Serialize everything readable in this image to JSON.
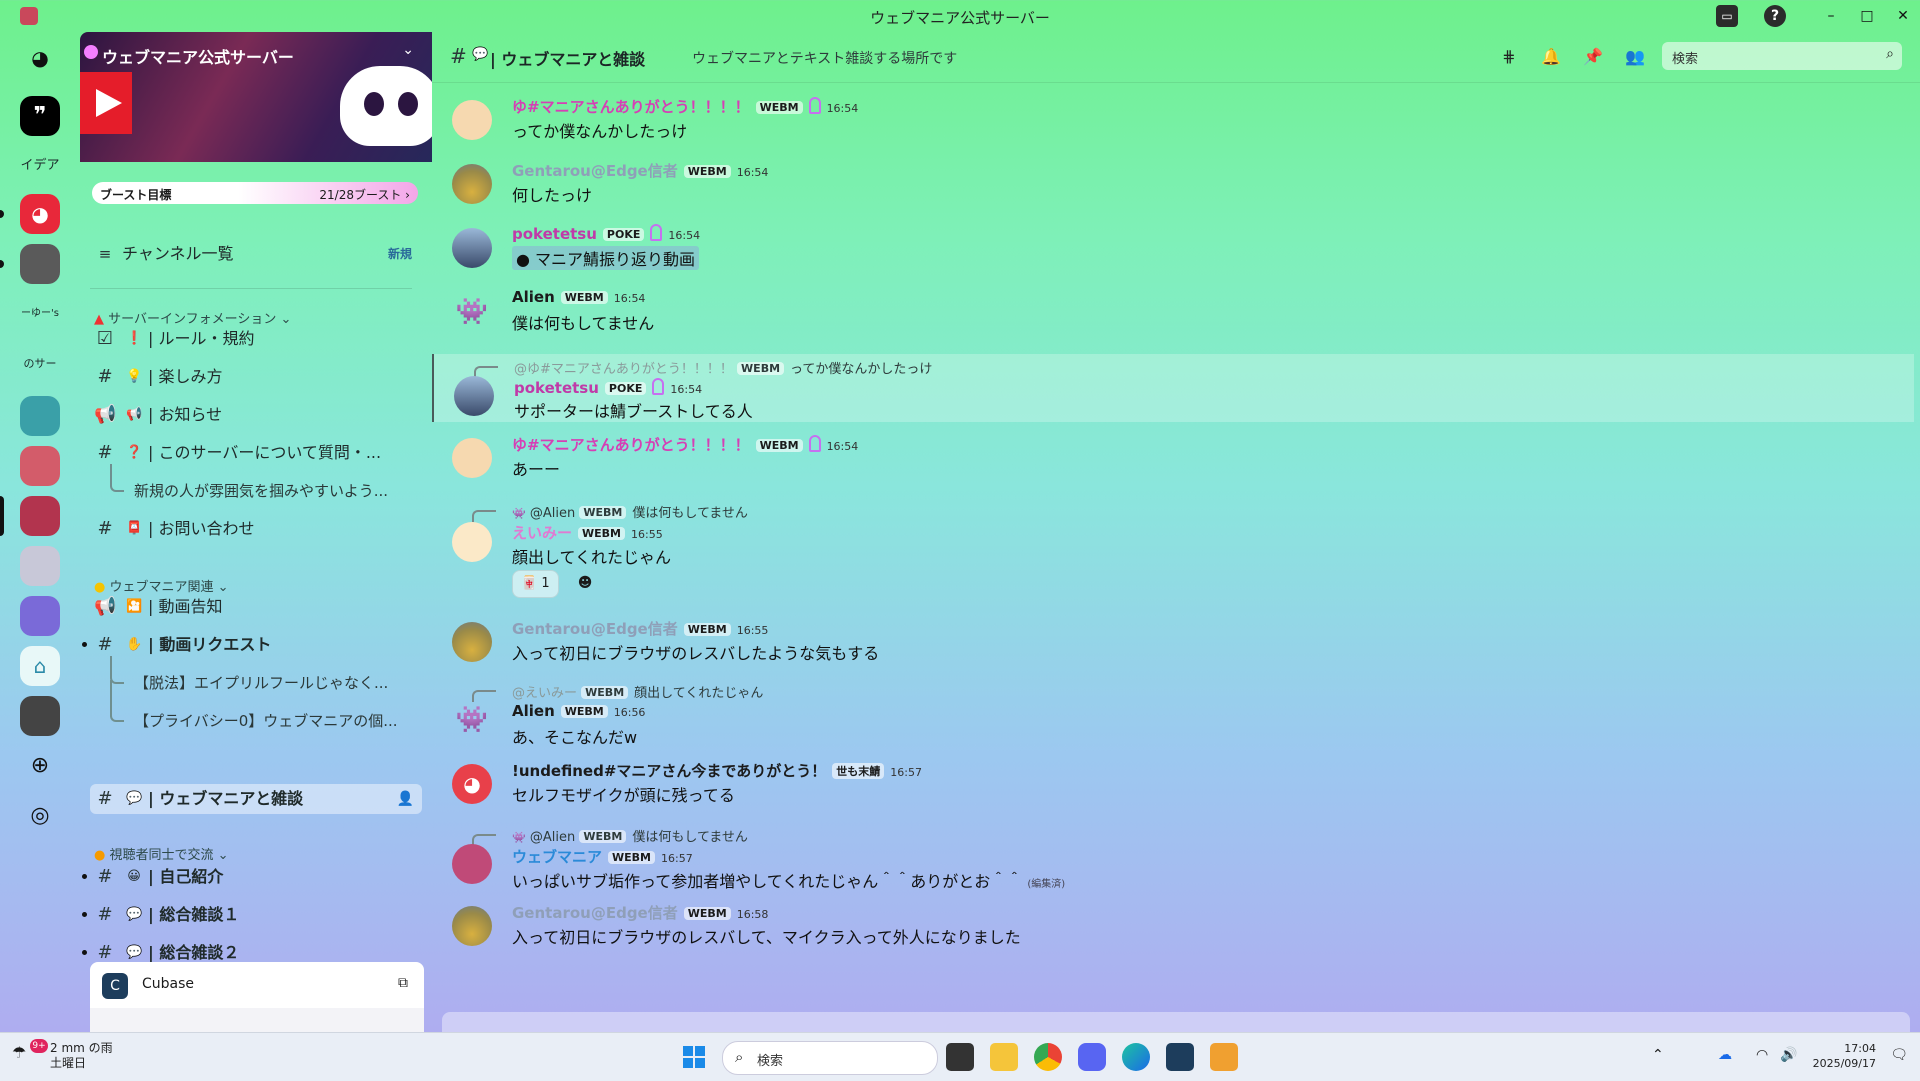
{
  "window": {
    "title": "ウェブマニア公式サーバー"
  },
  "rail": {
    "servers": [
      {
        "label": "イデア"
      },
      {
        "label": "ーゆー's"
      },
      {
        "label": "のサーバ"
      }
    ]
  },
  "sidebar": {
    "server_name": "ウェブマニア公式サーバー",
    "boost_label": "ブースト目標",
    "boost_count": "21/28ブースト ›",
    "channel_list": {
      "label": "チャンネル一覧",
      "badge": "新規"
    },
    "categories": [
      {
        "label": "サーバーインフォメーション ⌄",
        "channels": [
          {
            "emoji": "❗",
            "name": "| ルール・規約"
          },
          {
            "emoji": "💡",
            "name": "| 楽しみ方"
          },
          {
            "emoji": "📢",
            "name": "| お知らせ"
          },
          {
            "emoji": "❓",
            "name": "| このサーバーについて質問・..."
          },
          {
            "name": "新規の人が雰囲気を掴みやすいよう..."
          },
          {
            "emoji": "📮",
            "name": "| お問い合わせ"
          }
        ]
      },
      {
        "label": "ウェブマニア関連 ⌄",
        "channels": [
          {
            "emoji": "🎦",
            "name": "| 動画告知"
          },
          {
            "emoji": "✋",
            "name": "| 動画リクエスト"
          },
          {
            "name": "【脱法】エイプリルフールじゃなく..."
          },
          {
            "name": "【プライバシー0】ウェブマニアの個..."
          },
          {
            "emoji": "💬",
            "name": "| ウェブマニアと雑談"
          }
        ]
      },
      {
        "label": "視聴者同士で交流 ⌄",
        "channels": [
          {
            "emoji": "😀",
            "name": "| 自己紹介"
          },
          {
            "emoji": "💬",
            "name": "| 総合雑談１"
          },
          {
            "emoji": "💬",
            "name": "| 総合雑談２"
          }
        ]
      }
    ],
    "now_playing": "Cubase"
  },
  "header": {
    "channel_name": "| ウェブマニアと雑談",
    "topic": "ウェブマニアとテキスト雑談する場所です",
    "search_placeholder": "検索"
  },
  "messages": [
    {
      "author": "ゆ#マニアさんありがとう！！！！",
      "author_color": "#d63fb5",
      "tag": "WEBM",
      "time": "16:54",
      "text": "ってか僕なんかしたっけ"
    },
    {
      "author": "Gentarou@Edge信者",
      "author_color": "#8f9fb8",
      "tag": "WEBM",
      "time": "16:54",
      "text": "何したっけ"
    },
    {
      "author": "poketetsu",
      "author_color": "#c03aa8",
      "tag": "POKE",
      "time": "16:54",
      "text": "マニア鯖振り返り動画"
    },
    {
      "author": "Alien",
      "author_color": "#111111",
      "tag": "WEBM",
      "time": "16:54",
      "text": "僕は何もしてません"
    },
    {
      "reply_author": "@ゆ#マニアさんありがとう！！！！",
      "reply_tag": "WEBM",
      "reply_text": "ってか僕なんかしたっけ",
      "author": "poketetsu",
      "author_color": "#c03aa8",
      "tag": "POKE",
      "time": "16:54",
      "text": "サポーターは鯖ブーストしてる人"
    },
    {
      "author": "ゆ#マニアさんありがとう！！！！",
      "author_color": "#d63fb5",
      "tag": "WEBM",
      "time": "16:54",
      "text": "あーー"
    },
    {
      "reply_author": "@Alien",
      "reply_tag": "WEBM",
      "reply_text": "僕は何もしてません",
      "author": "えいみー",
      "author_color": "#e07ad2",
      "tag": "WEBM",
      "time": "16:55",
      "text": "顔出してくれたじゃん",
      "reaction": "1"
    },
    {
      "author": "Gentarou@Edge信者",
      "author_color": "#8f9fb8",
      "tag": "WEBM",
      "time": "16:55",
      "text": "入って初日にブラウザのレスバしたような気もする"
    },
    {
      "reply_author": "@えいみー",
      "reply_tag": "WEBM",
      "reply_text": "顔出してくれたじゃん",
      "author": "Alien",
      "author_color": "#111111",
      "tag": "WEBM",
      "time": "16:56",
      "text": "あ、そこなんだw"
    },
    {
      "author": "!undefined#マニアさん今までありがとう！",
      "author_color": "#111111",
      "tag": "世も末鯖",
      "time": "16:57",
      "text": "セルフモザイクが頭に残ってる"
    },
    {
      "reply_author": "@Alien",
      "reply_tag": "WEBM",
      "reply_text": "僕は何もしてません",
      "author": "ウェブマニア",
      "author_color": "#2a8ad8",
      "tag": "WEBM",
      "time": "16:57",
      "text": "いっぱいサブ垢作って参加者増やしてくれたじゃん＾＾ありがとお＾＾",
      "edited": "(編集済)"
    },
    {
      "author": "Gentarou@Edge信者",
      "author_color": "#8f9fb8",
      "tag": "WEBM",
      "time": "16:58",
      "text": "入って初日にブラウザのレスバして、マイクラ入って外人になりました"
    }
  ],
  "taskbar": {
    "weather_temp": "2 mm の雨",
    "weather_day": "土曜日",
    "badge": "9+",
    "search_placeholder": "検索",
    "time": "17:04",
    "date": "2025/09/17"
  }
}
